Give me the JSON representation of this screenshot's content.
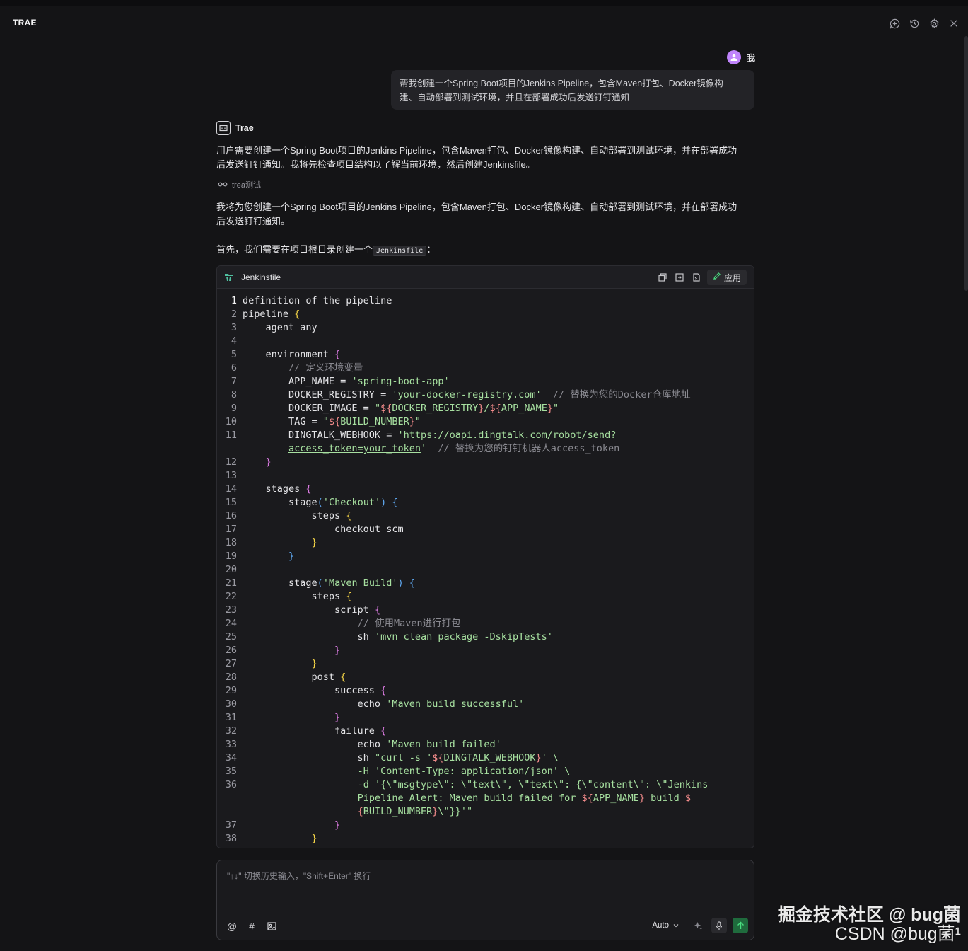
{
  "app": {
    "title": "TRAE"
  },
  "topbar": {
    "icons": [
      "new-chat-icon",
      "history-icon",
      "settings-icon",
      "close-icon"
    ]
  },
  "user": {
    "name": "我",
    "message_line1": "帮我创建一个Spring Boot项目的Jenkins Pipeline，包含Maven打包、Docker镜像构",
    "message_line2": "建、自动部署到测试环境，并且在部署成功后发送钉钉通知"
  },
  "assistant": {
    "name": "Trae",
    "thought_line1": "用户需要创建一个Spring Boot项目的Jenkins Pipeline，包含Maven打包、Docker镜像构建、自动部署到测试环境，并在部署成功",
    "thought_line2": "后发送钉钉通知。我将先检查项目结构以了解当前环境，然后创建Jenkinsfile。",
    "tool_label": "trea测试",
    "reply_line1": "我将为您创建一个Spring Boot项目的Jenkins Pipeline，包含Maven打包、Docker镜像构建、自动部署到测试环境，并在部署成功",
    "reply_line2": "后发送钉钉通知。",
    "intro_prefix": "首先，我们需要在项目根目录创建一个",
    "intro_code": "Jenkinsfile",
    "intro_suffix": "："
  },
  "code_block": {
    "file_name": "Jenkinsfile",
    "apply_label": "应用",
    "lines": [
      {
        "n": "1",
        "html": "definition of the pipeline"
      },
      {
        "n": "2",
        "html": "pipeline <span class=\"b2\">{</span>"
      },
      {
        "n": "3",
        "html": "    agent any"
      },
      {
        "n": "4",
        "html": ""
      },
      {
        "n": "5",
        "html": "    environment <span class=\"b1\">{</span>"
      },
      {
        "n": "6",
        "html": "        <span class=\"c\">// 定义环境变量</span>"
      },
      {
        "n": "7",
        "html": "        APP_NAME = <span class=\"s\">'spring-boot-app'</span>"
      },
      {
        "n": "8",
        "html": "        DOCKER_REGISTRY = <span class=\"s\">'your-docker-registry.com'</span>  <span class=\"c\">// 替换为您的Docker仓库地址</span>"
      },
      {
        "n": "9",
        "html": "        DOCKER_IMAGE = <span class=\"s\">\"</span><span class=\"v\">${</span><span class=\"s\">DOCKER_REGISTRY</span><span class=\"v\">}</span><span class=\"s\">/</span><span class=\"v\">${</span><span class=\"s\">APP_NAME</span><span class=\"v\">}</span><span class=\"s\">\"</span>"
      },
      {
        "n": "10",
        "html": "        TAG = <span class=\"s\">\"</span><span class=\"v\">${</span><span class=\"s\">BUILD_NUMBER</span><span class=\"v\">}</span><span class=\"s\">\"</span>"
      },
      {
        "n": "11",
        "html": "        DINGTALK_WEBHOOK = <span class=\"s\">'</span><span class=\"u\">https://oapi.dingtalk.com/robot/send?</span>"
      },
      {
        "n": "",
        "html": "        <span class=\"u\">access_token=your_token</span><span class=\"s\">'</span>  <span class=\"c\">// 替换为您的钉钉机器人access_token</span>"
      },
      {
        "n": "12",
        "html": "    <span class=\"b1\">}</span>"
      },
      {
        "n": "13",
        "html": ""
      },
      {
        "n": "14",
        "html": "    stages <span class=\"b1\">{</span>"
      },
      {
        "n": "15",
        "html": "        stage<span class=\"b3\">(</span><span class=\"s\">'Checkout'</span><span class=\"b3\">)</span> <span class=\"b3\">{</span>"
      },
      {
        "n": "16",
        "html": "            steps <span class=\"b2\">{</span>"
      },
      {
        "n": "17",
        "html": "                checkout scm"
      },
      {
        "n": "18",
        "html": "            <span class=\"b2\">}</span>"
      },
      {
        "n": "19",
        "html": "        <span class=\"b3\">}</span>"
      },
      {
        "n": "20",
        "html": ""
      },
      {
        "n": "21",
        "html": "        stage<span class=\"b3\">(</span><span class=\"s\">'Maven Build'</span><span class=\"b3\">)</span> <span class=\"b3\">{</span>"
      },
      {
        "n": "22",
        "html": "            steps <span class=\"b2\">{</span>"
      },
      {
        "n": "23",
        "html": "                script <span class=\"b1\">{</span>"
      },
      {
        "n": "24",
        "html": "                    <span class=\"c\">// 使用Maven进行打包</span>"
      },
      {
        "n": "25",
        "html": "                    sh <span class=\"s\">'mvn clean package -DskipTests'</span>"
      },
      {
        "n": "26",
        "html": "                <span class=\"b1\">}</span>"
      },
      {
        "n": "27",
        "html": "            <span class=\"b2\">}</span>"
      },
      {
        "n": "28",
        "html": "            post <span class=\"b2\">{</span>"
      },
      {
        "n": "29",
        "html": "                success <span class=\"b1\">{</span>"
      },
      {
        "n": "30",
        "html": "                    echo <span class=\"s\">'Maven build successful'</span>"
      },
      {
        "n": "31",
        "html": "                <span class=\"b1\">}</span>"
      },
      {
        "n": "32",
        "html": "                failure <span class=\"b1\">{</span>"
      },
      {
        "n": "33",
        "html": "                    echo <span class=\"s\">'Maven build failed'</span>"
      },
      {
        "n": "34",
        "html": "                    sh <span class=\"s\">\"curl -s '</span><span class=\"v\">${</span><span class=\"s\">DINGTALK_WEBHOOK</span><span class=\"v\">}</span><span class=\"s\">' \\</span>"
      },
      {
        "n": "35",
        "html": "                    <span class=\"s\">-H 'Content-Type: application/json' \\</span>"
      },
      {
        "n": "36",
        "html": "                    <span class=\"s\">-d '{\\\"msgtype\\\": \\\"text\\\", \\\"text\\\": {\\\"content\\\": \\\"Jenkins</span>"
      },
      {
        "n": "",
        "html": "                    <span class=\"s\">Pipeline Alert: Maven build failed for </span><span class=\"v\">${</span><span class=\"s\">APP_NAME</span><span class=\"v\">}</span><span class=\"s\"> build </span><span class=\"v\">$</span>"
      },
      {
        "n": "",
        "html": "                    <span class=\"v\">{</span><span class=\"s\">BUILD_NUMBER</span><span class=\"v\">}</span><span class=\"s\">\\\"}}'\"</span>"
      },
      {
        "n": "37",
        "html": "                <span class=\"b1\">}</span>"
      },
      {
        "n": "38",
        "html": "            <span class=\"b2\">}</span>"
      }
    ]
  },
  "input": {
    "placeholder": "\"↑↓\" 切换历史输入，\"Shift+Enter\" 换行",
    "model": "Auto"
  },
  "watermark": {
    "line1": "掘金技术社区 @ bug菌",
    "line2": "CSDN @bug菌¹"
  }
}
